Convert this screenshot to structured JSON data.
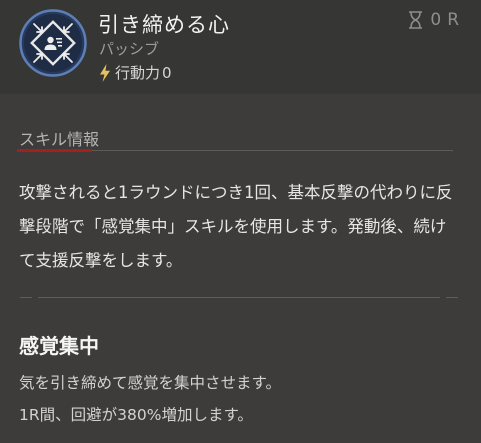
{
  "skill": {
    "name": "引き締める心",
    "type": "パッシブ",
    "action_label": "行動力",
    "action_value": "0",
    "icon": "person-focus-arrows-icon",
    "cooldown": {
      "icon": "hourglass-icon",
      "value": "0",
      "unit": "R"
    }
  },
  "info": {
    "section_label": "スキル情報",
    "description": "攻撃されると1ラウンドにつき1回、基本反撃の代わりに反撃段階で「感覚集中」スキルを使用します。発動後、続けて支援反撃をします。"
  },
  "buff": {
    "name": "感覚集中",
    "line1": "気を引き締めて感覚を集中させます。",
    "line2": "1R間、回避が380%増加します。"
  },
  "colors": {
    "background": "#3d3c3b",
    "header_background": "#363635",
    "icon_ring": "#5d7fb8",
    "accent_underline": "#a3201f"
  }
}
